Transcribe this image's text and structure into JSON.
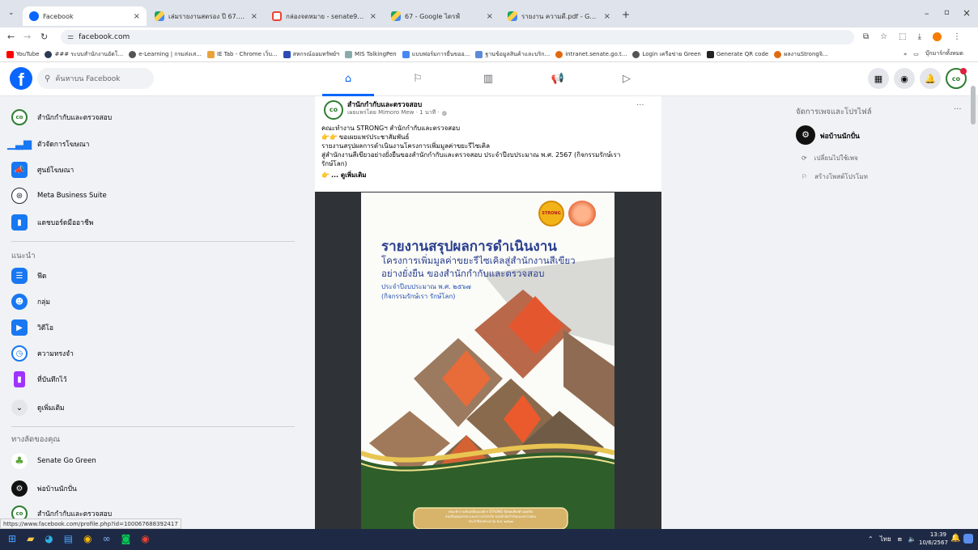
{
  "browser": {
    "tabs": [
      {
        "title": "Facebook",
        "active": true
      },
      {
        "title": "เล่มรายงานสตรอง ปี 67.pdf - Goo",
        "active": false
      },
      {
        "title": "กล่องจดหมาย - senate9329@gm",
        "active": false
      },
      {
        "title": "67 - Google ไดรฟ์",
        "active": false
      },
      {
        "title": "รายงาน ความดี.pdf - Google",
        "active": false
      }
    ],
    "new_tab": "+",
    "url": "facebook.com",
    "bookmarks": [
      "YouTube",
      "### ระบบสำนักงานอัตโ...",
      "e-Learning | กรมส่งเส...",
      "IE Tab - Chrome เว็บ...",
      "สหกรณ์ออมทรัพย์ฯ",
      "MIS TalkingPen",
      "แบบฟอร์มการยื่นขออ...",
      "ฐานข้อมูลสินค้าและบริก...",
      "intranet.senate.go.t...",
      "Login เครือข่าย Green",
      "Generate QR code",
      "ผลงานStrongจิ..."
    ],
    "bookmarks_more": "»",
    "bookmarks_folder": "บุ๊กมาร์กทั้งหมด",
    "status_url": "https://www.facebook.com/profile.php?id=100067688392417"
  },
  "fb": {
    "search_placeholder": "ค้นหาบน Facebook",
    "left_nav": [
      {
        "label": "สำนักกำกับและตรวจสอบ",
        "icon": "page-avatar-icon"
      },
      {
        "label": "ตัวจัดการโฆษณา",
        "icon": "ads-manager-icon"
      },
      {
        "label": "ศูนย์โฆษณา",
        "icon": "megaphone-icon"
      },
      {
        "label": "Meta Business Suite",
        "icon": "meta-business-icon"
      },
      {
        "label": "แดชบอร์ดมืออาชีพ",
        "icon": "dashboard-icon"
      }
    ],
    "suggested_header": "แนะนำ",
    "suggested": [
      {
        "label": "ฟีด",
        "icon": "feed-icon"
      },
      {
        "label": "กลุ่ม",
        "icon": "groups-icon"
      },
      {
        "label": "วิดีโอ",
        "icon": "video-icon"
      },
      {
        "label": "ความทรงจำ",
        "icon": "memories-icon"
      },
      {
        "label": "ที่บันทึกไว้",
        "icon": "saved-icon"
      },
      {
        "label": "ดูเพิ่มเติม",
        "icon": "chevron-down-icon"
      }
    ],
    "shortcuts_header": "ทางลัดของคุณ",
    "shortcuts": [
      {
        "label": "Senate Go Green",
        "icon": "go-green-icon"
      },
      {
        "label": "พ่อบ้านนักปั่น",
        "icon": "cyclist-avatar-icon"
      },
      {
        "label": "สำนักกำกับและตรวจสอบ",
        "icon": "page-avatar-icon"
      }
    ],
    "post": {
      "author": "สำนักกำกับและตรวจสอบ",
      "meta": "เผยแพร่โดย Mimoro Mew · 1 นาที ·",
      "more": "···",
      "lines": [
        "คณะทำงาน STRONGฯ สำนักกำกับและตรวจสอบ",
        "ขอเผยแพร่ประชาสัมพันธ์",
        "รายงานสรุปผลการดำเนินงานโครงการเพิ่มมูลค่าขยะรีไซเคิล",
        "สู่สำนักงานสีเขียวอย่างยั่งยืนของสำนักกำกับและตรวจสอบ ประจำปีงบประมาณ พ.ศ. 2567 (กิจกรรมรักษ์เรา",
        "รักษ์โลก)"
      ],
      "see_more": "... ดูเพิ่มเติม"
    },
    "poster": {
      "badge": "STRONG",
      "title": "รายงานสรุปผลการดำเนินงาน",
      "subtitle1": "โครงการเพิ่มมูลค่าขยะรีไซเคิลสู่สำนักงานสีเขียว",
      "subtitle2": "อย่างยั่งยืน ของสำนักกำกับและตรวจสอบ",
      "year": "ประจำปีงบประมาณ พ.ศ. ๒๕๖๗",
      "activity": "(กิจกรรมรักษ์เรา รักษ์โลก)",
      "footer1": "คณะทำงานขับเคลื่อนองค์กร STRONG จิตพอเพียงต้านทุจริต",
      "footer2": "ส่งเสริมคุณธรรม และความโปร่งใส ของสำนักกำกับและตรวจสอบ",
      "footer3": "ประจำปีงบประมาณ พ.ศ. ๒๕๖๗"
    },
    "right": {
      "header": "จัดการเพจและโปรไฟล์",
      "more": "···",
      "profile_name": "พ่อบ้านนักปั่น",
      "switch_label": "เปลี่ยนไปใช้เพจ",
      "create_promo": "สร้างโพสต์โปรโมท"
    }
  },
  "taskbar": {
    "time": "13:39",
    "date": "10/6/2567",
    "lang": "ไทย"
  }
}
